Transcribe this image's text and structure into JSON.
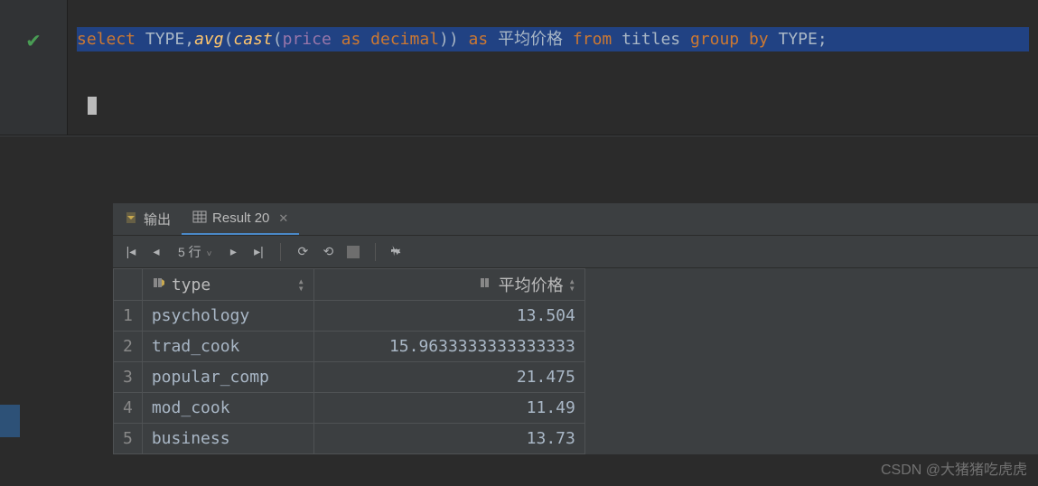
{
  "editor": {
    "sql_tokens": [
      {
        "t": "select ",
        "c": "kw"
      },
      {
        "t": "TYPE",
        "c": "txt"
      },
      {
        "t": ",",
        "c": "punc"
      },
      {
        "t": "avg",
        "c": "fn"
      },
      {
        "t": "(",
        "c": "punc"
      },
      {
        "t": "cast",
        "c": "fn"
      },
      {
        "t": "(",
        "c": "punc"
      },
      {
        "t": "price ",
        "c": "id"
      },
      {
        "t": "as ",
        "c": "kw"
      },
      {
        "t": "decimal",
        "c": "ty"
      },
      {
        "t": ")) ",
        "c": "punc"
      },
      {
        "t": "as ",
        "c": "kw"
      },
      {
        "t": "平均价格 ",
        "c": "zhcol"
      },
      {
        "t": "from ",
        "c": "kw"
      },
      {
        "t": "titles ",
        "c": "txt"
      },
      {
        "t": "group by ",
        "c": "kw"
      },
      {
        "t": "TYPE",
        "c": "txt"
      },
      {
        "t": ";",
        "c": "punc"
      }
    ],
    "status_icon": "check"
  },
  "tabs": {
    "output_label": "输出",
    "result_label": "Result 20"
  },
  "toolbar": {
    "row_info": "5 行",
    "row_info_suffix": "˅"
  },
  "columns": {
    "type_label": "type",
    "avg_label": "平均价格"
  },
  "rows": [
    {
      "n": "1",
      "type": "psychology",
      "avg": "13.504"
    },
    {
      "n": "2",
      "type": "trad_cook",
      "avg": "15.9633333333333333"
    },
    {
      "n": "3",
      "type": "popular_comp",
      "avg": "21.475"
    },
    {
      "n": "4",
      "type": "mod_cook",
      "avg": "11.49"
    },
    {
      "n": "5",
      "type": "business",
      "avg": "13.73"
    }
  ],
  "watermark": "CSDN @大猪猪吃虎虎"
}
